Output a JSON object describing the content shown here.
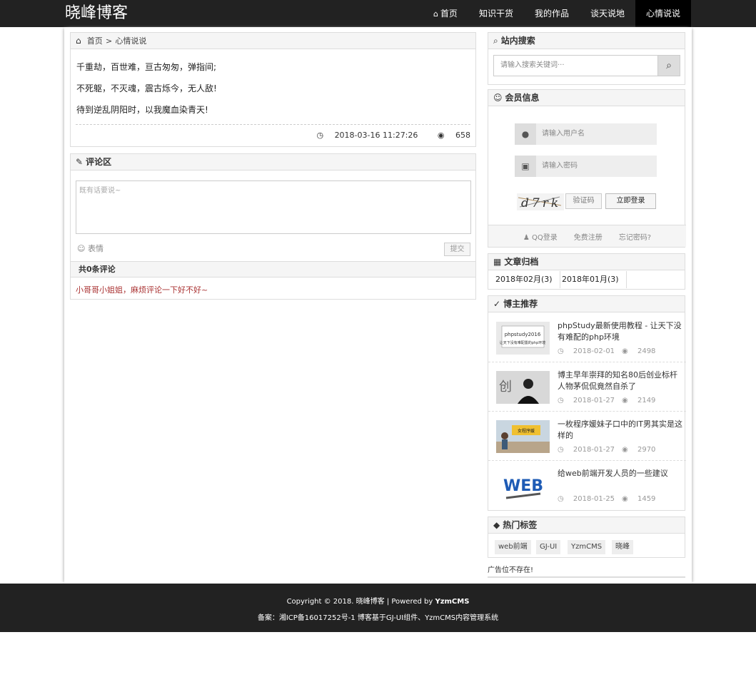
{
  "site": {
    "logo": "晓峰博客"
  },
  "nav": [
    {
      "label": "首页",
      "icon": "home-icon",
      "active": false
    },
    {
      "label": "知识干货",
      "active": false
    },
    {
      "label": "我的作品",
      "active": false
    },
    {
      "label": "谈天说地",
      "active": false
    },
    {
      "label": "心情说说",
      "active": true
    }
  ],
  "breadcrumb": {
    "home": "首页",
    "sep": ">",
    "current": "心情说说"
  },
  "article": {
    "lines": [
      "千重劫，百世难，亘古匆匆，弹指间;",
      "不死躯，不灭魂，震古烁今，无人敌!",
      "待到逆乱阴阳时，以我魔血染青天!"
    ],
    "date": "2018-03-16 11:27:26",
    "views": "658"
  },
  "comments": {
    "title": "评论区",
    "placeholder": "既有话要说~",
    "emote_label": "表情",
    "submit_label": "提交",
    "count_label": "共0条评论",
    "empty_message": "小哥哥小姐姐，麻烦评论一下好不好~"
  },
  "search": {
    "title": "站内搜索",
    "placeholder": "请输入搜索关键词···"
  },
  "member": {
    "title": "会员信息",
    "username_placeholder": "请输入用户名",
    "password_placeholder": "请输入密码",
    "captcha_text": "d7rk",
    "code_placeholder": "验证码",
    "login_label": "立即登录",
    "qq_login": "QQ登录",
    "register": "免费注册",
    "forgot": "忘记密码?"
  },
  "archive": {
    "title": "文章归档",
    "items": [
      "2018年02月(3)",
      "2018年01月(3)"
    ]
  },
  "recommend": {
    "title": "博主推荐",
    "items": [
      {
        "title": "phpStudy最新使用教程 - 让天下没有难配的php环境",
        "date": "2018-02-01",
        "views": "2498",
        "thumb_text": "phpstudy2016",
        "thumb_sub": "让天下没有难配置的php环境"
      },
      {
        "title": "博主早年崇拜的知名80后创业标杆人物茅侃侃竟然自杀了",
        "date": "2018-01-27",
        "views": "2149",
        "thumb_text": "创"
      },
      {
        "title": "一枚程序媛妹子口中的IT男其实是这样的",
        "date": "2018-01-27",
        "views": "2970",
        "thumb_text": "女程序媛"
      },
      {
        "title": "给web前端开发人员的一些建议",
        "date": "2018-01-25",
        "views": "1459",
        "thumb_text": "WEB"
      }
    ]
  },
  "tags": {
    "title": "热门标签",
    "items": [
      "web前端",
      "GJ-UI",
      "YzmCMS",
      "晓峰"
    ]
  },
  "ad_text": "广告位不存在!",
  "footer": {
    "copyright": "Copyright © 2018. 晓峰博客 | Powered by ",
    "powered_brand": "YzmCMS",
    "icp": "备案：湘ICP备16017252号-1 博客基于GJ-UI组件、YzmCMS内容管理系统"
  },
  "colors": {
    "topbar": "#222222",
    "nav_active": "#000000",
    "panel_head": "#f5f5f5",
    "border": "#dddddd",
    "comment_empty": "#aa3333"
  }
}
